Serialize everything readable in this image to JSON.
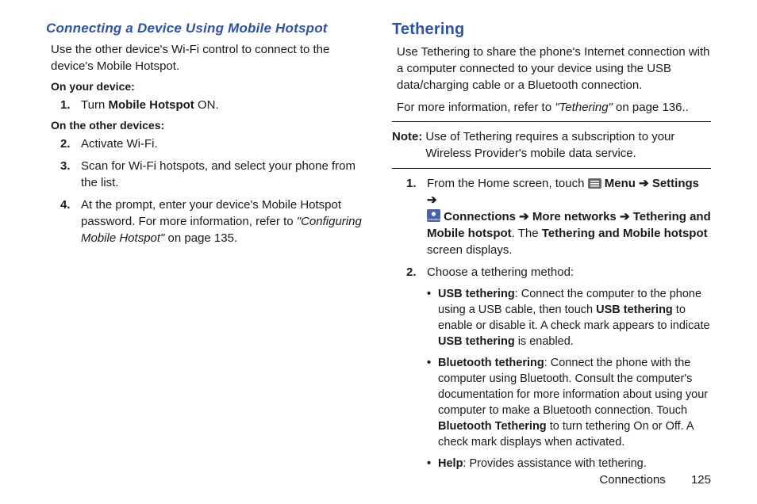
{
  "left": {
    "heading": "Connecting a Device Using Mobile Hotspot",
    "intro": "Use the other device's Wi-Fi control to connect to the device's Mobile Hotspot.",
    "subhead_a": "On your device:",
    "step1_num": "1.",
    "step1_a": "Turn ",
    "step1_b": "Mobile Hotspot",
    "step1_c": " ON.",
    "subhead_b": "On the other devices:",
    "step2_num": "2.",
    "step2": "Activate Wi-Fi.",
    "step3_num": "3.",
    "step3": "Scan for Wi-Fi hotspots, and select your phone from the list.",
    "step4_num": "4.",
    "step4_a": "At the prompt, enter your device's Mobile Hotspot password. For more information, refer to ",
    "step4_b": "\"Configuring Mobile Hotspot\"",
    "step4_c": " on page 135."
  },
  "right": {
    "heading": "Tethering",
    "intro": "Use Tethering to share the phone's Internet connection with a computer connected to your device using the USB data/charging cable or a Bluetooth connection.",
    "more_a": "For more information, refer to ",
    "more_b": "\"Tethering\"",
    "more_c": " on page 136..",
    "note_label": "Note:",
    "note_text": "Use of Tethering requires a subscription to your Wireless Provider's mobile data service.",
    "step1_num": "1.",
    "step1_a": "From the Home screen, touch ",
    "step1_menu": " Menu ",
    "arrow": "➔",
    "step1_settings": " Settings ",
    "step1_connections": " Connections ",
    "step1_more": " More networks ",
    "step1_teth": " Tethering and Mobile hotspot",
    "step1_mid": ". The ",
    "step1_teth2": "Tethering and Mobile hotspot",
    "step1_end": " screen displays.",
    "step2_num": "2.",
    "step2": "Choose a tethering method:",
    "b1_lead": "USB tethering",
    "b1_a": ": Connect the computer to the phone using a USB cable, then touch ",
    "b1_b": "USB tethering",
    "b1_c": " to enable or disable it. A check mark appears to indicate ",
    "b1_d": "USB tethering",
    "b1_e": " is enabled.",
    "b2_lead": "Bluetooth tethering",
    "b2_a": ": Connect the phone with the computer using Bluetooth. Consult the computer's documentation for more information about using your computer to make a Bluetooth connection. Touch ",
    "b2_b": "Bluetooth Tethering",
    "b2_c": " to turn tethering On or Off. A check mark displays when activated.",
    "b3_lead": "Help",
    "b3_a": ": Provides assistance with tethering."
  },
  "footer": {
    "section": "Connections",
    "page": "125"
  }
}
